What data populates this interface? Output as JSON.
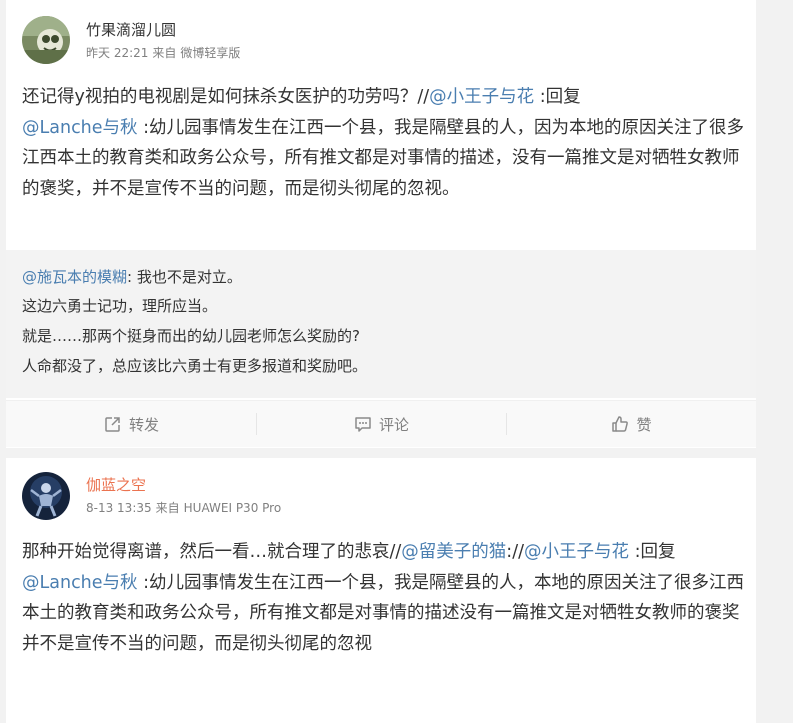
{
  "posts": [
    {
      "username": "竹果滴溜儿圆",
      "time": "昨天 22:21",
      "source_prefix": "来自",
      "source": "微博轻享版",
      "text": {
        "p1": "还记得y视拍的电视剧是如何抹杀女医护的功劳吗？//",
        "m1": "@小王子与花",
        "p2": " :回复",
        "m2": "@Lanche与秋",
        "p3": " :幼儿园事情发生在江西一个县，我是隔壁县的人，因为本地的原因关注了很多江西本土的教育类和政务公众号，所有推文都是对事情的描述，没有一篇推文是对牺牲女教师的褒奖，并不是宣传不当的问题，而是彻头彻尾的忽视。"
      },
      "quote": {
        "user": "@施瓦本的模糊",
        "line1": ": 我也不是对立。",
        "line2": "这边六勇士记功，理所应当。",
        "line3": "就是……那两个挺身而出的幼儿园老师怎么奖励的?",
        "line4": "人命都没了，总应该比六勇士有更多报道和奖励吧。"
      },
      "actions": {
        "repost": "转发",
        "comment": "评论",
        "like": "赞"
      },
      "icons": {
        "repost": "repost-icon",
        "comment": "comment-icon",
        "like": "thumbs-up-icon"
      }
    },
    {
      "username": "伽蓝之空",
      "time": "8-13 13:35",
      "source_prefix": "来自",
      "source": "HUAWEI P30 Pro",
      "text": {
        "p1": "那种开始觉得离谱，然后一看…就合理了的悲哀//",
        "m1": "@留美子的猫",
        "p2": ":",
        "p2b": "//",
        "m2": "@小王子与花",
        "p3": " :回复",
        "m3": "@Lanche与秋",
        "p4": " :幼儿园事情发生在江西一个县，我是隔壁县的人，本地的原因关注了很多江西本土的教育类和政务公众号，所有推文都是对事情的描述没有一篇推文是对牺牲女教师的褒奖并不是宣传不当的问题，而是彻头彻尾的忽视"
      }
    }
  ],
  "colors": {
    "mention": "#eb7350",
    "quote_user": "#4a7eb0",
    "username_orange": "#eb7350",
    "text": "#333333",
    "meta": "#808080",
    "background": "#f2f2f2"
  }
}
